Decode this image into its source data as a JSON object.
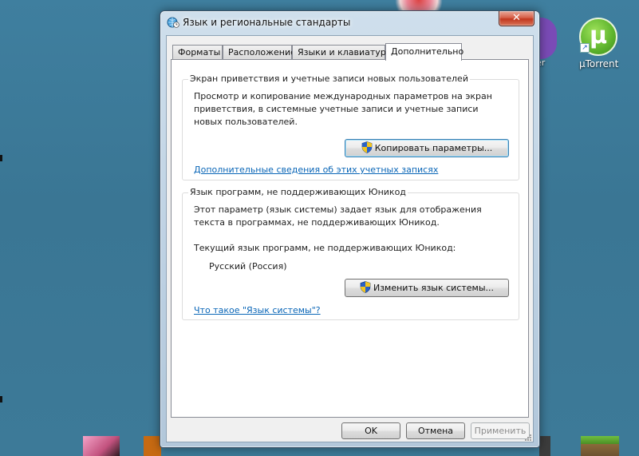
{
  "desktop": {
    "viber_label": "er",
    "utorrent_label": "µTorrent",
    "utorrent_glyph": "µ",
    "shortcut_glyph": "↗"
  },
  "window": {
    "title": "Язык и региональные стандарты",
    "close_glyph": "✕",
    "tabs": [
      {
        "label": "Форматы"
      },
      {
        "label": "Расположение"
      },
      {
        "label": "Языки и клавиатуры"
      },
      {
        "label": "Дополнительно",
        "active": true
      }
    ],
    "welcome_group": {
      "legend": "Экран приветствия и учетные записи новых пользователей",
      "description": "Просмотр и копирование международных параметров на экран приветствия, в системные учетные записи и учетные записи новых пользователей.",
      "copy_button": "Копировать параметры...",
      "link": "Дополнительные сведения об этих учетных записях"
    },
    "unicode_group": {
      "legend": "Язык программ, не поддерживающих Юникод",
      "description": "Этот параметр (язык системы) задает язык для отображения текста в программах, не поддерживающих Юникод.",
      "current_label": "Текущий язык программ, не поддерживающих Юникод:",
      "current_value": "Русский (Россия)",
      "change_button": "Изменить язык системы...",
      "link": "Что такое \"Язык системы\"?"
    },
    "footer": {
      "ok": "OK",
      "cancel": "Отмена",
      "apply": "Применить"
    },
    "icons": {
      "title": "globe-clock-icon",
      "shield": "uac-shield-icon"
    }
  }
}
